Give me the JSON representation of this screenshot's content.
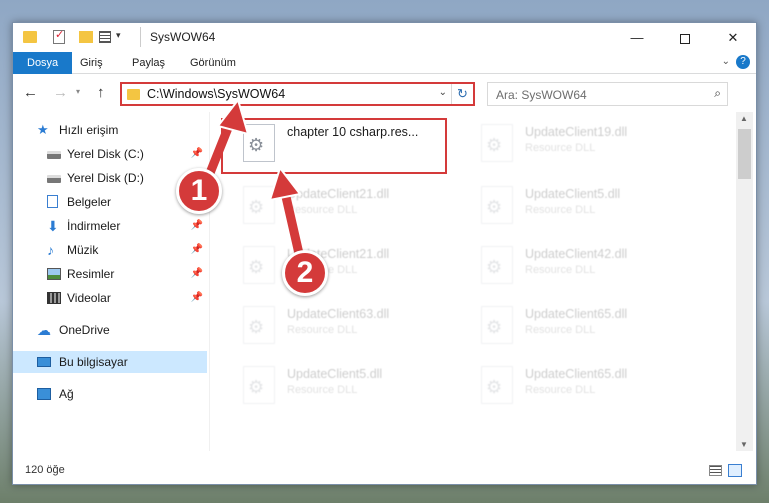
{
  "window": {
    "title": "SysWOW64",
    "min_label": "—",
    "close_label": "✕"
  },
  "ribbon": {
    "tabs": [
      "Dosya",
      "Giriş",
      "Paylaş",
      "Görünüm"
    ],
    "expand_icon": "chevron-down-icon",
    "help_label": "?"
  },
  "nav": {
    "back": "←",
    "forward": "→",
    "recent": "▾",
    "up": "↑"
  },
  "address": {
    "path": "C:\\Windows\\SysWOW64",
    "dropdown": "⌄",
    "refresh": "↻"
  },
  "search": {
    "placeholder": "Ara: SysWOW64",
    "icon": "⌕"
  },
  "sidebar": {
    "items": [
      {
        "label": "Hızlı erişim",
        "icon": "star-icon",
        "pinned": false
      },
      {
        "label": "Yerel Disk (C:)",
        "icon": "drive-icon",
        "pinned": true
      },
      {
        "label": "Yerel Disk (D:)",
        "icon": "drive-icon",
        "pinned": false
      },
      {
        "label": "Belgeler",
        "icon": "documents-icon",
        "pinned": true
      },
      {
        "label": "İndirmeler",
        "icon": "downloads-icon",
        "pinned": true
      },
      {
        "label": "Müzik",
        "icon": "music-icon",
        "pinned": true
      },
      {
        "label": "Resimler",
        "icon": "pictures-icon",
        "pinned": true
      },
      {
        "label": "Videolar",
        "icon": "videos-icon",
        "pinned": true
      },
      {
        "label": "OneDrive",
        "icon": "cloud-icon",
        "pinned": false
      },
      {
        "label": "Bu bilgisayar",
        "icon": "computer-icon",
        "pinned": false,
        "selected": true
      },
      {
        "label": "Ağ",
        "icon": "network-icon",
        "pinned": false
      }
    ],
    "pin_glyph": "📌"
  },
  "files": {
    "left": [
      {
        "name": "chapter 10 csharp.res...",
        "type": ""
      },
      {
        "name": "UpdateClient21.dll",
        "type": "Resource DLL"
      },
      {
        "name": "UpdateClient21.dll",
        "type": "Resource DLL"
      },
      {
        "name": "UpdateClient63.dll",
        "type": "Resource DLL"
      },
      {
        "name": "UpdateClient5.dll",
        "type": "Resource DLL"
      }
    ],
    "right": [
      {
        "name": "UpdateClient19.dll",
        "type": "Resource DLL"
      },
      {
        "name": "UpdateClient5.dll",
        "type": "Resource DLL"
      },
      {
        "name": "UpdateClient42.dll",
        "type": "Resource DLL"
      },
      {
        "name": "UpdateClient65.dll",
        "type": "Resource DLL"
      },
      {
        "name": "UpdateClient65.dll",
        "type": "Resource DLL"
      }
    ]
  },
  "status": {
    "count": "120 öğe"
  },
  "annotations": {
    "step1": "1",
    "step2": "2",
    "color": "#d43a3a"
  }
}
